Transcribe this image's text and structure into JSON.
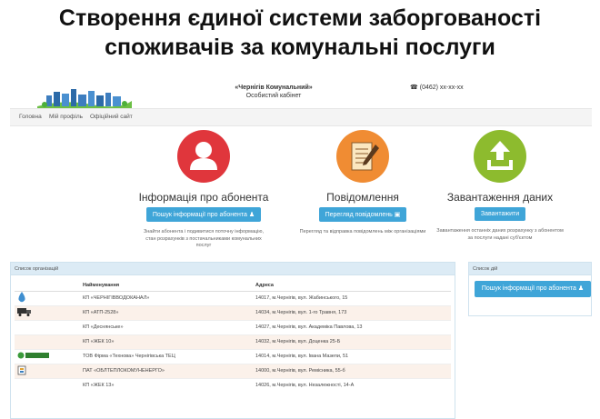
{
  "slide_title": "Створення єдиної системи заборгованості\nспоживачів за комунальні послуги",
  "header": {
    "org_name": "«Чернігів Комунальний»",
    "subtitle": "Особистий кабінет",
    "phone": "(0462) xx-xx-xx"
  },
  "nav": [
    "Головна",
    "Мій профіль",
    "Офіційний сайт"
  ],
  "features": [
    {
      "title": "Інформація про абонента",
      "button": "Пошук інформації про абонента",
      "description": "Знайти абонента і подивитися поточну інформацію, стан розрахунків з постачальниками комунальних послуг",
      "icon": "user-icon",
      "color": "#e0363c"
    },
    {
      "title": "Повідомлення",
      "button": "Перегляд повідомлень",
      "description": "Перегляд та відправка повідомлень між організаціями",
      "icon": "document-pen-icon",
      "color": "#f08c33"
    },
    {
      "title": "Завантаження даних",
      "button": "Завантажити",
      "description": "Завантаження останніх даних розрахунку з абонентом за послуги надані суб'єктом",
      "icon": "upload-icon",
      "color": "#8dbb2e"
    }
  ],
  "org_panel": {
    "title": "Список організацій",
    "columns": [
      "",
      "Найменування",
      "Адреса"
    ],
    "rows": [
      {
        "icon": "water-drop-icon",
        "name": "КП «ЧЕРНІГІВВОДОКАНАЛ»",
        "address": "14017, м.Чернігів, вул. Жабинського, 15"
      },
      {
        "icon": "truck-icon",
        "name": "КП «АТП-2528»",
        "address": "14034, м.Чернігів, вул. 1-го Травня, 173"
      },
      {
        "icon": "",
        "name": "КП «Деснянське»",
        "address": "14027, м.Чернігів, вул. Академіка Павлова, 13"
      },
      {
        "icon": "",
        "name": "КП «ЖЕК 10»",
        "address": "14032, м.Чернігів, вул. Доценка 25-Б"
      },
      {
        "icon": "technova-logo",
        "name": "ТОВ Фірма «Технова» Чернігівська ТЕЦ",
        "address": "14014, м.Чернігів, вул. Івана Мазепи, 51"
      },
      {
        "icon": "building-logo",
        "name": "ПАТ «ОБЛТЕПЛОКОМУНЕНЕРГО»",
        "address": "14000, м.Чернігів, вул. Ремісника, 55-б"
      },
      {
        "icon": "",
        "name": "КП «ЖЕК 13»",
        "address": "14026, м.Чернігів, вул. Незалежності, 14-А"
      }
    ]
  },
  "actions_panel": {
    "title": "Список дій",
    "button": "Пошук інформації про абонента"
  }
}
